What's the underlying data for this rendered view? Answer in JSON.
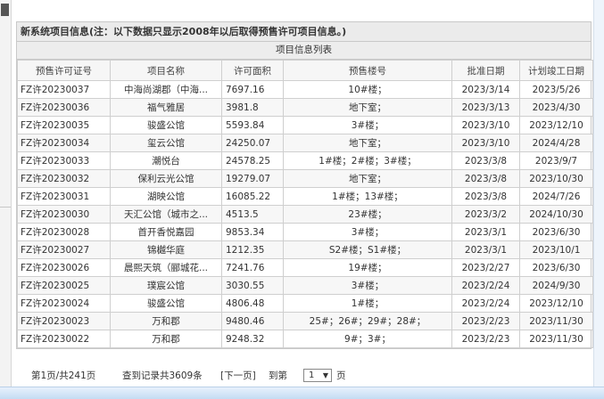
{
  "panel": {
    "title": "新系统项目信息(注：以下数据只显示2008年以后取得预售许可项目信息。)",
    "list_title": "项目信息列表"
  },
  "table": {
    "headers": [
      "预售许可证号",
      "项目名称",
      "许可面积",
      "预售楼号",
      "批准日期",
      "计划竣工日期"
    ],
    "rows": [
      [
        "FZ许20230037",
        "中海尚湖郡（中海...",
        "7697.16",
        "10#楼；",
        "2023/3/14",
        "2023/5/26"
      ],
      [
        "FZ许20230036",
        "福气雅居",
        "3981.8",
        "地下室；",
        "2023/3/13",
        "2023/4/30"
      ],
      [
        "FZ许20230035",
        "骏盛公馆",
        "5593.84",
        "3#楼；",
        "2023/3/10",
        "2023/12/10"
      ],
      [
        "FZ许20230034",
        "玺云公馆",
        "24250.07",
        "地下室；",
        "2023/3/10",
        "2024/4/28"
      ],
      [
        "FZ许20230033",
        "潮悦台",
        "24578.25",
        "1#楼；2#楼；3#楼；",
        "2023/3/8",
        "2023/9/7"
      ],
      [
        "FZ许20230032",
        "保利云光公馆",
        "19279.07",
        "地下室；",
        "2023/3/8",
        "2023/10/30"
      ],
      [
        "FZ许20230031",
        "湖映公馆",
        "16085.22",
        "1#楼；13#楼；",
        "2023/3/8",
        "2024/7/26"
      ],
      [
        "FZ许20230030",
        "天汇公馆（城市之...",
        "4513.5",
        "23#楼；",
        "2023/3/2",
        "2024/10/30"
      ],
      [
        "FZ许20230028",
        "首开香悦嘉园",
        "9853.34",
        "3#楼；",
        "2023/3/1",
        "2023/6/30"
      ],
      [
        "FZ许20230027",
        "锦樾华庭",
        "1212.35",
        "S2#楼；S1#楼；",
        "2023/3/1",
        "2023/10/1"
      ],
      [
        "FZ许20230026",
        "晨熙天筑（郦城花...",
        "7241.76",
        "19#楼；",
        "2023/2/27",
        "2023/6/30"
      ],
      [
        "FZ许20230025",
        "璞宸公馆",
        "3030.55",
        "3#楼；",
        "2023/2/24",
        "2024/9/30"
      ],
      [
        "FZ许20230024",
        "骏盛公馆",
        "4806.48",
        "1#楼；",
        "2023/2/24",
        "2023/12/10"
      ],
      [
        "FZ许20230023",
        "万和郡",
        "9480.46",
        "25#；26#；29#；28#；",
        "2023/2/23",
        "2023/11/30"
      ],
      [
        "FZ许20230022",
        "万和郡",
        "9248.32",
        "9#；3#；",
        "2023/2/23",
        "2023/11/30"
      ]
    ]
  },
  "pager": {
    "page_info": "第1页/共241页",
    "record_info": "查到记录共3609条",
    "next_label": "[下一页]",
    "goto_label": "到第",
    "page_value": "1",
    "page_suffix": "页"
  }
}
